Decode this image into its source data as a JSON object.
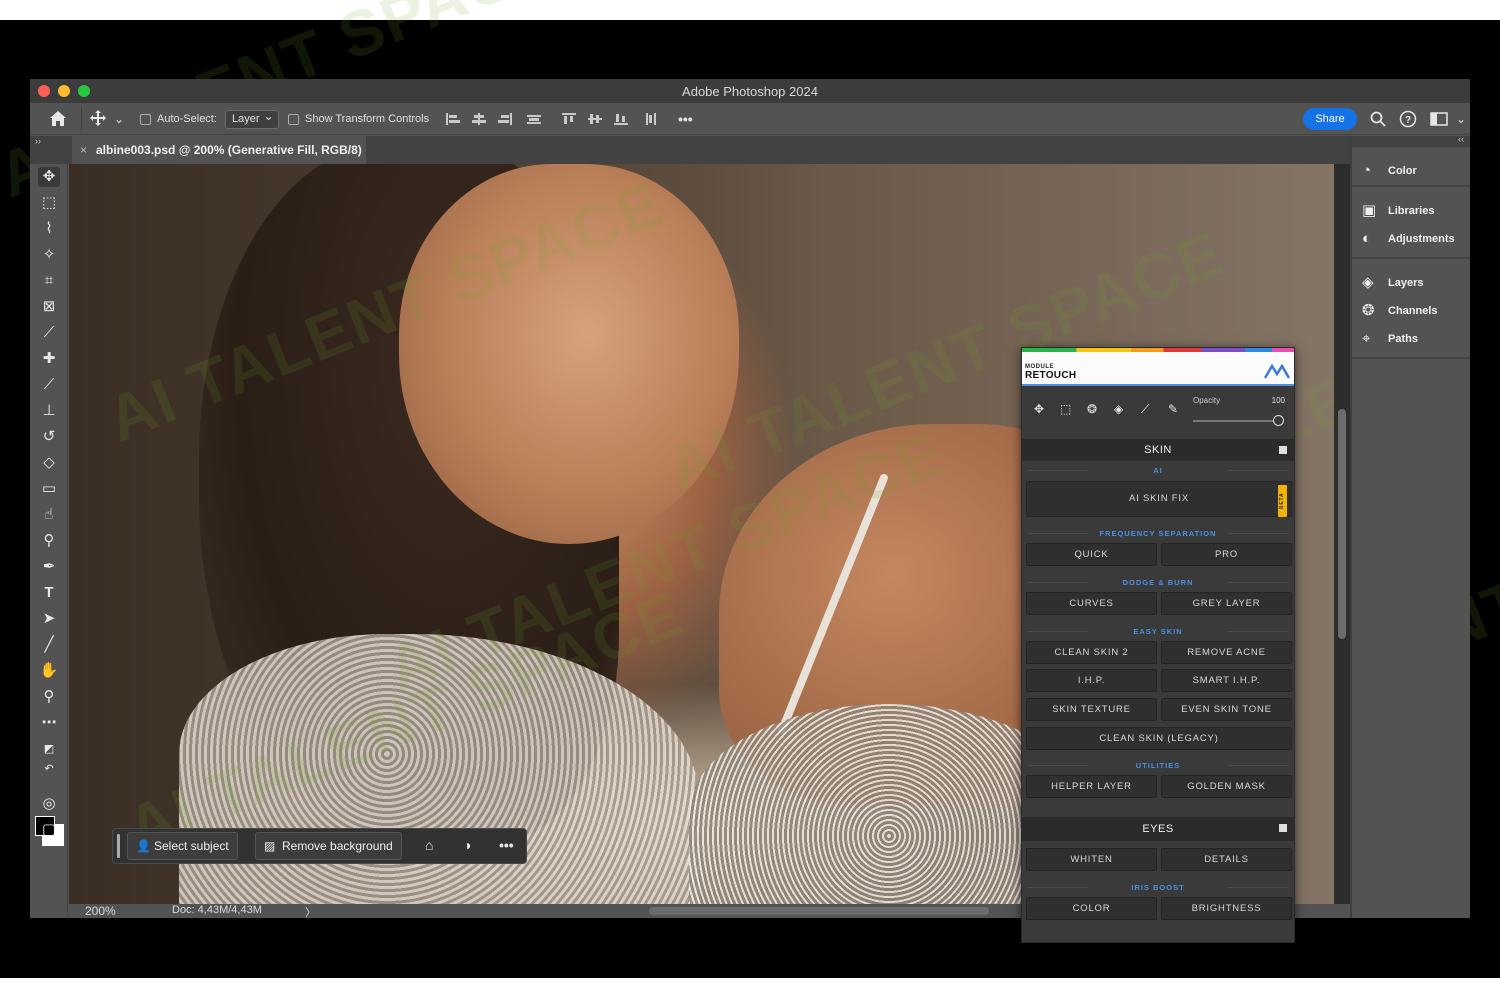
{
  "window": {
    "title": "Adobe Photoshop 2024"
  },
  "options_bar": {
    "auto_select_label": "Auto-Select:",
    "auto_select_value": "Layer",
    "show_transform_label": "Show Transform Controls",
    "more_label": "•••",
    "share_label": "Share"
  },
  "document": {
    "tab_title": "albine003.psd @ 200% (Generative Fill, RGB/8)",
    "close_glyph": "×",
    "zoom": "200%",
    "doc_size": "Doc: 4,43M/4,43M",
    "status_arrow": "〉"
  },
  "collapse": {
    "left": "››",
    "right": "‹‹"
  },
  "contextual_taskbar": {
    "select_subject": "Select subject",
    "remove_background": "Remove background",
    "more": "•••"
  },
  "watermark_text": "AI TALENT SPACE",
  "dock": {
    "color": "Color",
    "libraries": "Libraries",
    "adjustments": "Adjustments",
    "layers": "Layers",
    "channels": "Channels",
    "paths": "Paths"
  },
  "retouch": {
    "module_label": "MODULE",
    "retouch_label": "RETOUCH",
    "opacity_label": "Opacity",
    "opacity_value": "100",
    "beta_label": "BETA",
    "skin": {
      "title": "SKIN",
      "ai_label": "AI",
      "ai_skin_fix": "AI SKIN FIX",
      "freq_label": "FREQUENCY SEPARATION",
      "quick": "QUICK",
      "pro": "PRO",
      "dodge_label": "DODGE & BURN",
      "curves": "CURVES",
      "grey_layer": "GREY LAYER",
      "easy_label": "EASY SKIN",
      "clean_skin_2": "CLEAN SKIN 2",
      "remove_acne": "REMOVE ACNE",
      "ihp": "I.H.P.",
      "smart_ihp": "SMART I.H.P.",
      "skin_texture": "SKIN TEXTURE",
      "even_skin_tone": "EVEN SKIN TONE",
      "clean_skin_legacy": "CLEAN SKIN (LEGACY)",
      "utilities_label": "UTILITIES",
      "helper_layer": "HELPER LAYER",
      "golden_mask": "GOLDEN MASK"
    },
    "eyes": {
      "title": "EYES",
      "whiten": "WHITEN",
      "details": "DETAILS",
      "iris_label": "IRIS BOOST",
      "color": "COLOR",
      "brightness": "BRIGHTNESS"
    }
  },
  "colors": {
    "accent": "#1473e6",
    "panel": "#535353",
    "section_blue": "#4a90e2",
    "beta": "#f2b400"
  }
}
